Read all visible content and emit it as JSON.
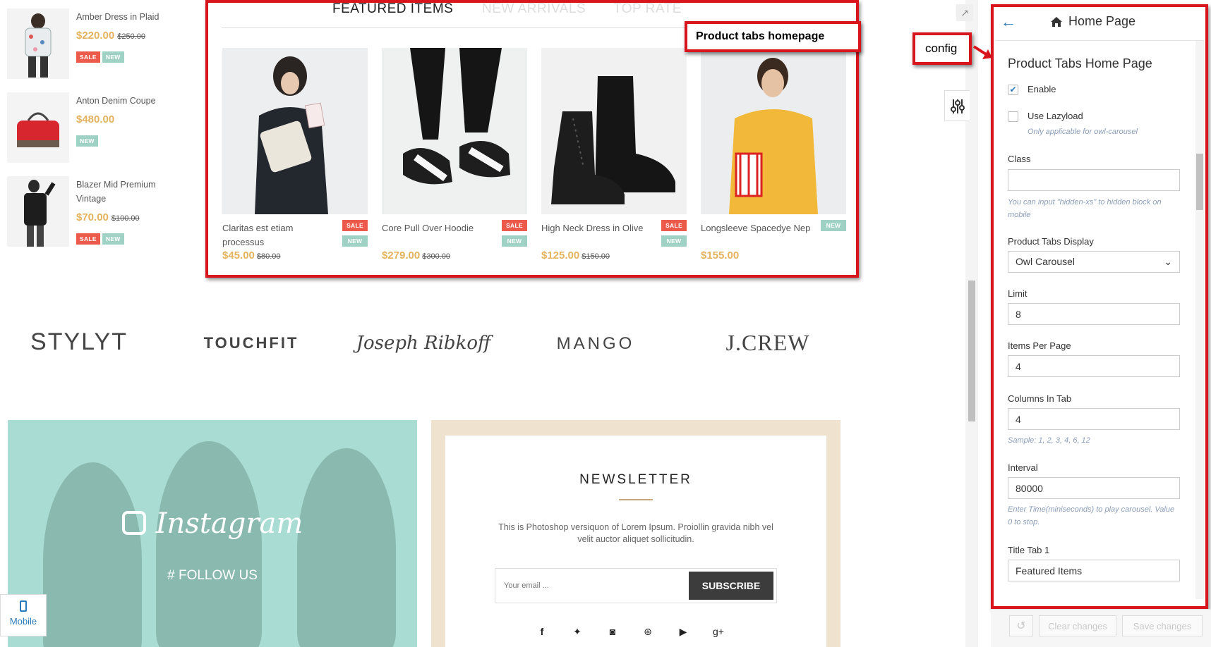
{
  "sidebar_products": [
    {
      "name": "Amber Dress in Plaid",
      "price": "$220.00",
      "old_price": "$250.00",
      "badges": [
        "SALE",
        "NEW"
      ]
    },
    {
      "name": "Anton Denim Coupe",
      "price": "$480.00",
      "old_price": "",
      "badges": [
        "NEW"
      ]
    },
    {
      "name": "Blazer Mid Premium Vintage",
      "price": "$70.00",
      "old_price": "$100.00",
      "badges": [
        "SALE",
        "NEW"
      ]
    }
  ],
  "product_tabs": {
    "tabs": [
      "FEATURED ITEMS",
      "NEW ARRIVALS",
      "TOP RATE"
    ],
    "active_tab": "FEATURED ITEMS",
    "annotation": "Product tabs homepage",
    "products": [
      {
        "name": "Claritas est etiam processus",
        "price": "$45.00",
        "old_price": "$80.00",
        "badges": [
          "SALE",
          "NEW"
        ]
      },
      {
        "name": "Core Pull Over Hoodie",
        "price": "$279.00",
        "old_price": "$300.00",
        "badges": [
          "SALE",
          "NEW"
        ]
      },
      {
        "name": "High Neck Dress in Olive",
        "price": "$125.00",
        "old_price": "$150.00",
        "badges": [
          "SALE",
          "NEW"
        ]
      },
      {
        "name": "Longsleeve Spacedye Nep",
        "price": "$155.00",
        "old_price": "",
        "badges": [
          "NEW"
        ]
      }
    ]
  },
  "brands": [
    "STYLYT",
    "TOUCHFIT",
    "Joseph Ribkoff",
    "MANGO",
    "J.CREW"
  ],
  "instagram": {
    "title": "Instagram",
    "follow": "# FOLLOW US"
  },
  "mobile_label": "Mobile",
  "newsletter": {
    "title": "NEWSLETTER",
    "text": "This is Photoshop versiquon of Lorem Ipsum. Proiollin gravida nibh vel velit auctor aliquet sollicitudin.",
    "placeholder": "Your email ...",
    "button": "SUBSCRIBE"
  },
  "config_annotation": "config",
  "panel": {
    "header": "Home Page",
    "section_title": "Product Tabs Home Page",
    "enable_label": "Enable",
    "enable_checked": true,
    "lazyload_label": "Use Lazyload",
    "lazyload_checked": false,
    "lazyload_note": "Only applicable for owl-carousel",
    "class_label": "Class",
    "class_value": "",
    "class_note": "You can input \"hidden-xs\" to hidden block on mobile",
    "display_label": "Product Tabs Display",
    "display_value": "Owl Carousel",
    "limit_label": "Limit",
    "limit_value": "8",
    "items_label": "Items Per Page",
    "items_value": "4",
    "columns_label": "Columns In Tab",
    "columns_value": "4",
    "columns_note": "Sample: 1, 2, 3, 4, 6, 12",
    "interval_label": "Interval",
    "interval_value": "80000",
    "interval_note": "Enter Time(miniseconds) to play carousel. Value 0 to stop.",
    "title_tab1_label": "Title Tab 1",
    "title_tab1_value": "Featured Items",
    "clear_label": "Clear changes",
    "save_label": "Save changes"
  },
  "colors": {
    "accent": "#d8141c",
    "price": "#e3b35e",
    "link": "#2a7ab9",
    "sale": "#ec5a4b",
    "new": "#9fd2c4"
  }
}
